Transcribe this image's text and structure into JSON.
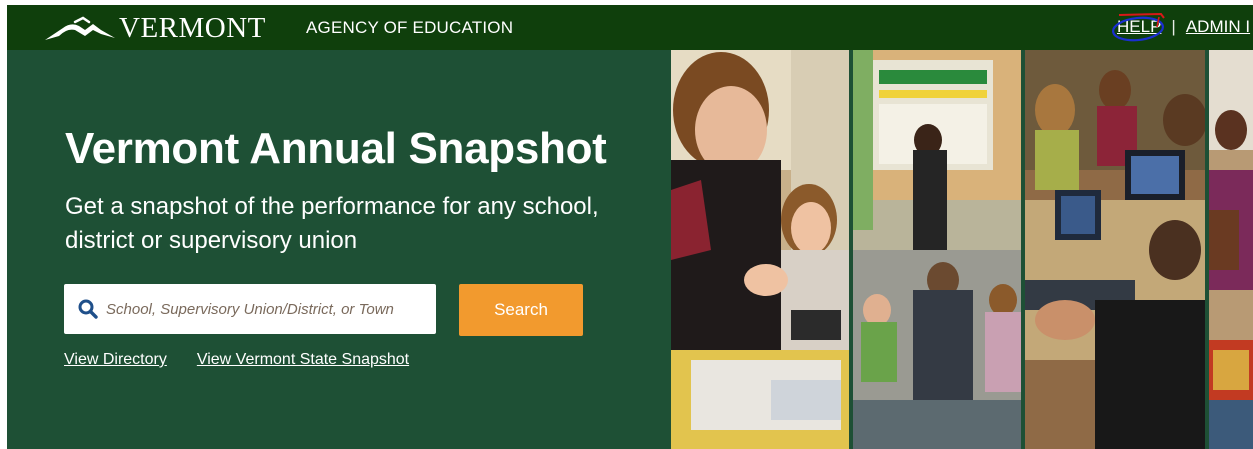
{
  "header": {
    "logo_text": "VERMONT",
    "agency": "AGENCY OF EDUCATION",
    "links": {
      "help": "HELP",
      "separator": "|",
      "admin": "ADMIN I"
    },
    "colors": {
      "bar": "#0f3f0c",
      "mark_blue": "#1a2fd0",
      "mark_red": "#d81818"
    }
  },
  "hero": {
    "title": "Vermont Annual Snapshot",
    "subtitle": "Get a snapshot of the performance for any school, district or supervisory union",
    "search": {
      "icon": "search-icon",
      "placeholder": "School, Supervisory Union/District, or Town",
      "value": "",
      "button_label": "Search"
    },
    "links": {
      "directory": "View Directory",
      "state": "View Vermont State Snapshot"
    },
    "colors": {
      "background": "#1e5035",
      "button": "#f29a2e"
    }
  },
  "photos": [
    {
      "subject": "girls-painting-in-classroom"
    },
    {
      "subject": "teacher-with-seated-students"
    },
    {
      "subject": "students-using-laptops"
    },
    {
      "subject": "students-playing-music"
    }
  ]
}
